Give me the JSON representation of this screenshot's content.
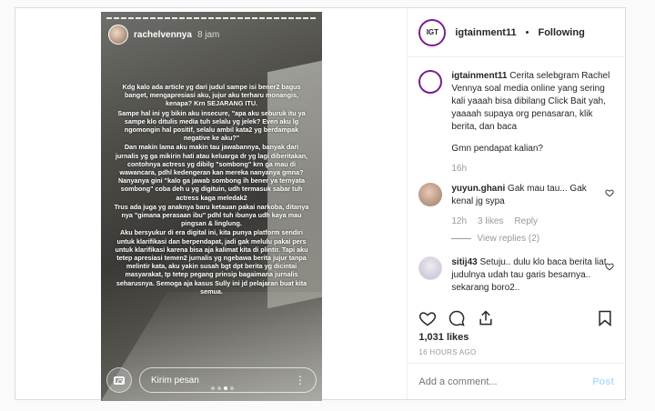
{
  "nav": {
    "prev_glyph": "‹"
  },
  "story": {
    "username": "rachelvennya",
    "time": "8 jam",
    "paragraphs": [
      "Kdg kalo ada article yg dari judul sampe isi bener2 bagus banget, mengapresiasi aku, jujur aku terharu monangis, kenapa? Krn SEJARANG ITU.",
      "Sampe hal ini yg bikin aku insecure, \"apa aku seburuk itu ya sampe klo ditulis media tuh selalu yg jelek? Even aku lg ngomongin hal positif, selalu ambil kata2 yg berdampak negative ke aku?\"",
      "Dan makin lama aku makin tau jawabannya, banyak dari jurnalis yg ga mikirin hati atau keluarga dr yg lagi diberitakan, contohnya actress yg dibilg \"sombong\" krn ga mau di wawancara, pdhl kedengeran kan mereka nanyanya gmna? Nanyanya gini \"kalo ga jawab sombong ih bener ya ternyata sombong\" coba deh u yg digituin, udh termasuk sabar tuh actress kaga meledak2",
      "Trus ada juga yg anaknya baru ketauan pakai narkoba, ditanya nya \"gimana perasaan ibu\" pdhl tuh ibunya udh kaya mau pingsan & linglung.",
      "Aku bersyukur di era digital ini, kita punya platform sendiri untuk klarifikasi dan berpendapat, jadi gak melulu pakai pers untuk klarifikasi karena bisa aja kalimat kita di plintir. Tapi aku tetep apresiasi temen2 jurnalis yg ngebawa berita jujur tanpa melintir kata, aku yakin susah bgt dpt berita yg dicintai masyarakat, tp tetep pegang prinsip bagaimana jurnalis seharusnya. Semoga aja kasus Sully ini jd pelajaran buat kita semua."
    ],
    "reply_placeholder": "Kirim pesan",
    "more_glyph": "⋮"
  },
  "post": {
    "account": "igtainment11",
    "separator": "•",
    "follow_status": "Following",
    "avatar_text": "IGT",
    "caption_user": "igtainment11",
    "caption_text": "Cerita selebgram Rachel Vennya soal media online yang sering kali yaaah bisa dibilang Click Bait yah, yaaaah supaya org penasaran, klik berita, dan baca",
    "caption_extra": "Gmn pendapat kalian?",
    "caption_age": "16h",
    "comments": [
      {
        "user": "yuyun.ghani",
        "text": "Gak mau tau... Gak kenal jg sypa",
        "age": "12h",
        "likes": "3 likes",
        "reply": "Reply",
        "view_replies": "View replies (2)"
      },
      {
        "user": "sitij43",
        "text": "Setuju.. dulu klo baca berita liat judulnya udah tau garis besarnya.. sekarang boro2..",
        "age": "",
        "likes": "",
        "reply": "",
        "view_replies": ""
      }
    ],
    "likes": "1,031 likes",
    "time_ago": "16 HOURS AGO",
    "add_comment_placeholder": "Add a comment...",
    "post_label": "Post"
  }
}
